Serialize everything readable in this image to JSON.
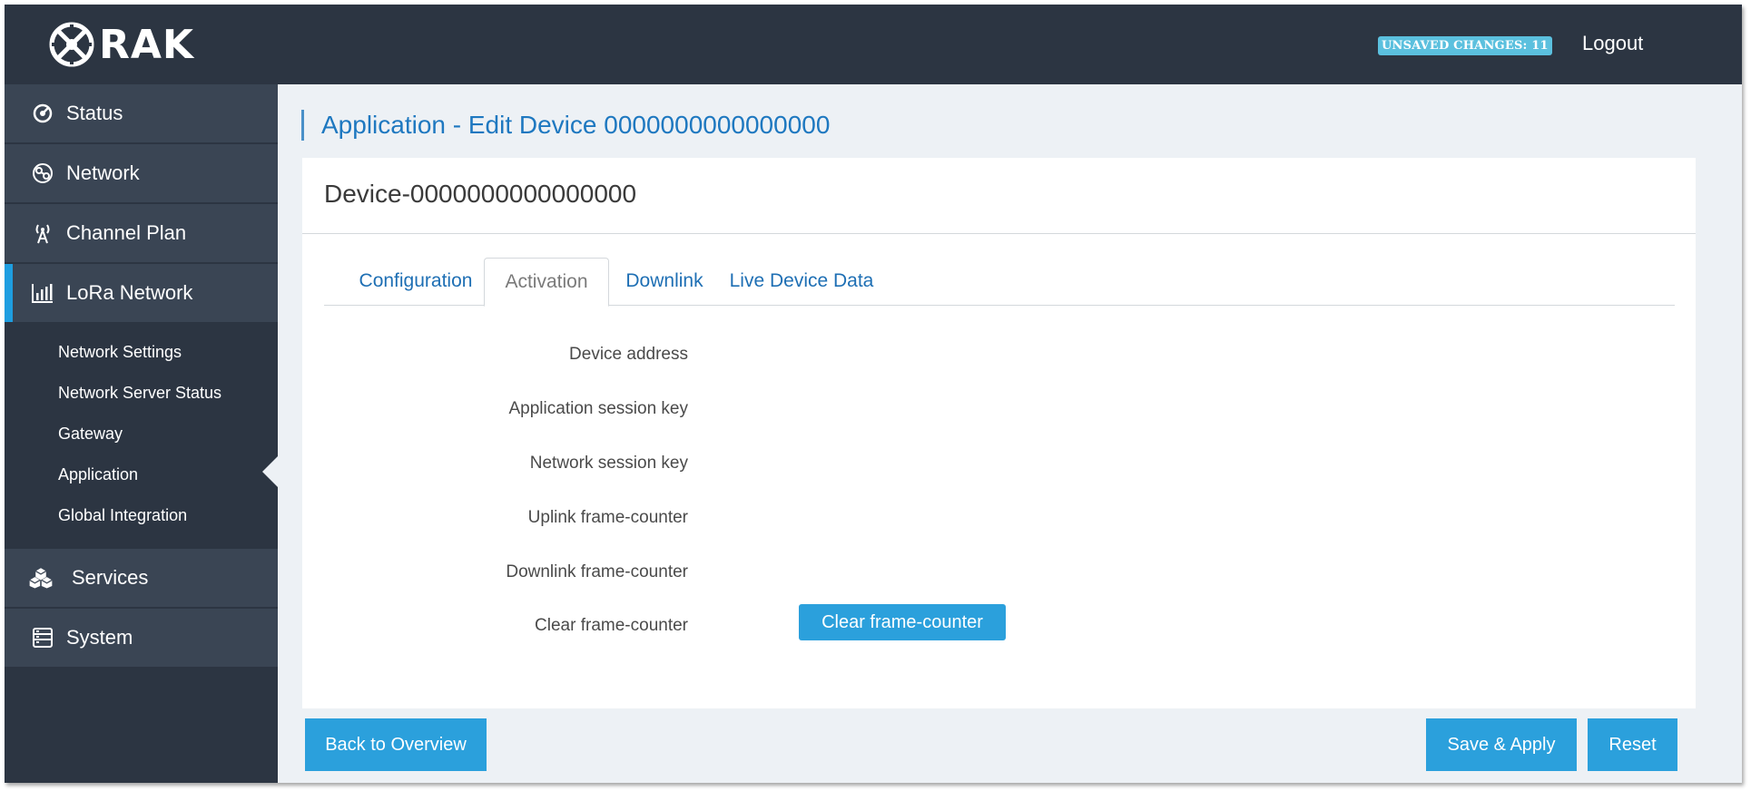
{
  "header": {
    "logo_text": "RAK",
    "unsaved_changes": "UNSAVED CHANGES: 11",
    "logout_label": "Logout"
  },
  "sidebar": {
    "items": [
      {
        "label": "Status",
        "icon": "status-icon"
      },
      {
        "label": "Network",
        "icon": "network-icon"
      },
      {
        "label": "Channel Plan",
        "icon": "antenna-icon"
      },
      {
        "label": "LoRa Network",
        "icon": "signal-bars-icon",
        "active": true
      },
      {
        "label": "Services",
        "icon": "cubes-icon"
      },
      {
        "label": "System",
        "icon": "server-icon"
      }
    ],
    "subitems": [
      {
        "label": "Network Settings"
      },
      {
        "label": "Network Server Status"
      },
      {
        "label": "Gateway"
      },
      {
        "label": "Application",
        "selected": true
      },
      {
        "label": "Global Integration"
      }
    ]
  },
  "main": {
    "page_title": "Application - Edit Device 0000000000000000",
    "card_title": "Device-0000000000000000",
    "tabs": [
      {
        "label": "Configuration"
      },
      {
        "label": "Activation",
        "active": true
      },
      {
        "label": "Downlink"
      },
      {
        "label": "Live Device Data"
      }
    ],
    "fields": [
      {
        "label": "Device address"
      },
      {
        "label": "Application session key"
      },
      {
        "label": "Network session key"
      },
      {
        "label": "Uplink frame-counter"
      },
      {
        "label": "Downlink frame-counter"
      },
      {
        "label": "Clear frame-counter"
      }
    ],
    "clear_button": "Clear frame-counter"
  },
  "footer": {
    "back_label": "Back to Overview",
    "save_label": "Save & Apply",
    "reset_label": "Reset"
  },
  "colors": {
    "header_bg": "#2c3542",
    "sidebar_item_bg": "#3a4554",
    "accent": "#2ba0dc",
    "title_blue": "#1e78c0",
    "badge": "#5bc0de"
  }
}
